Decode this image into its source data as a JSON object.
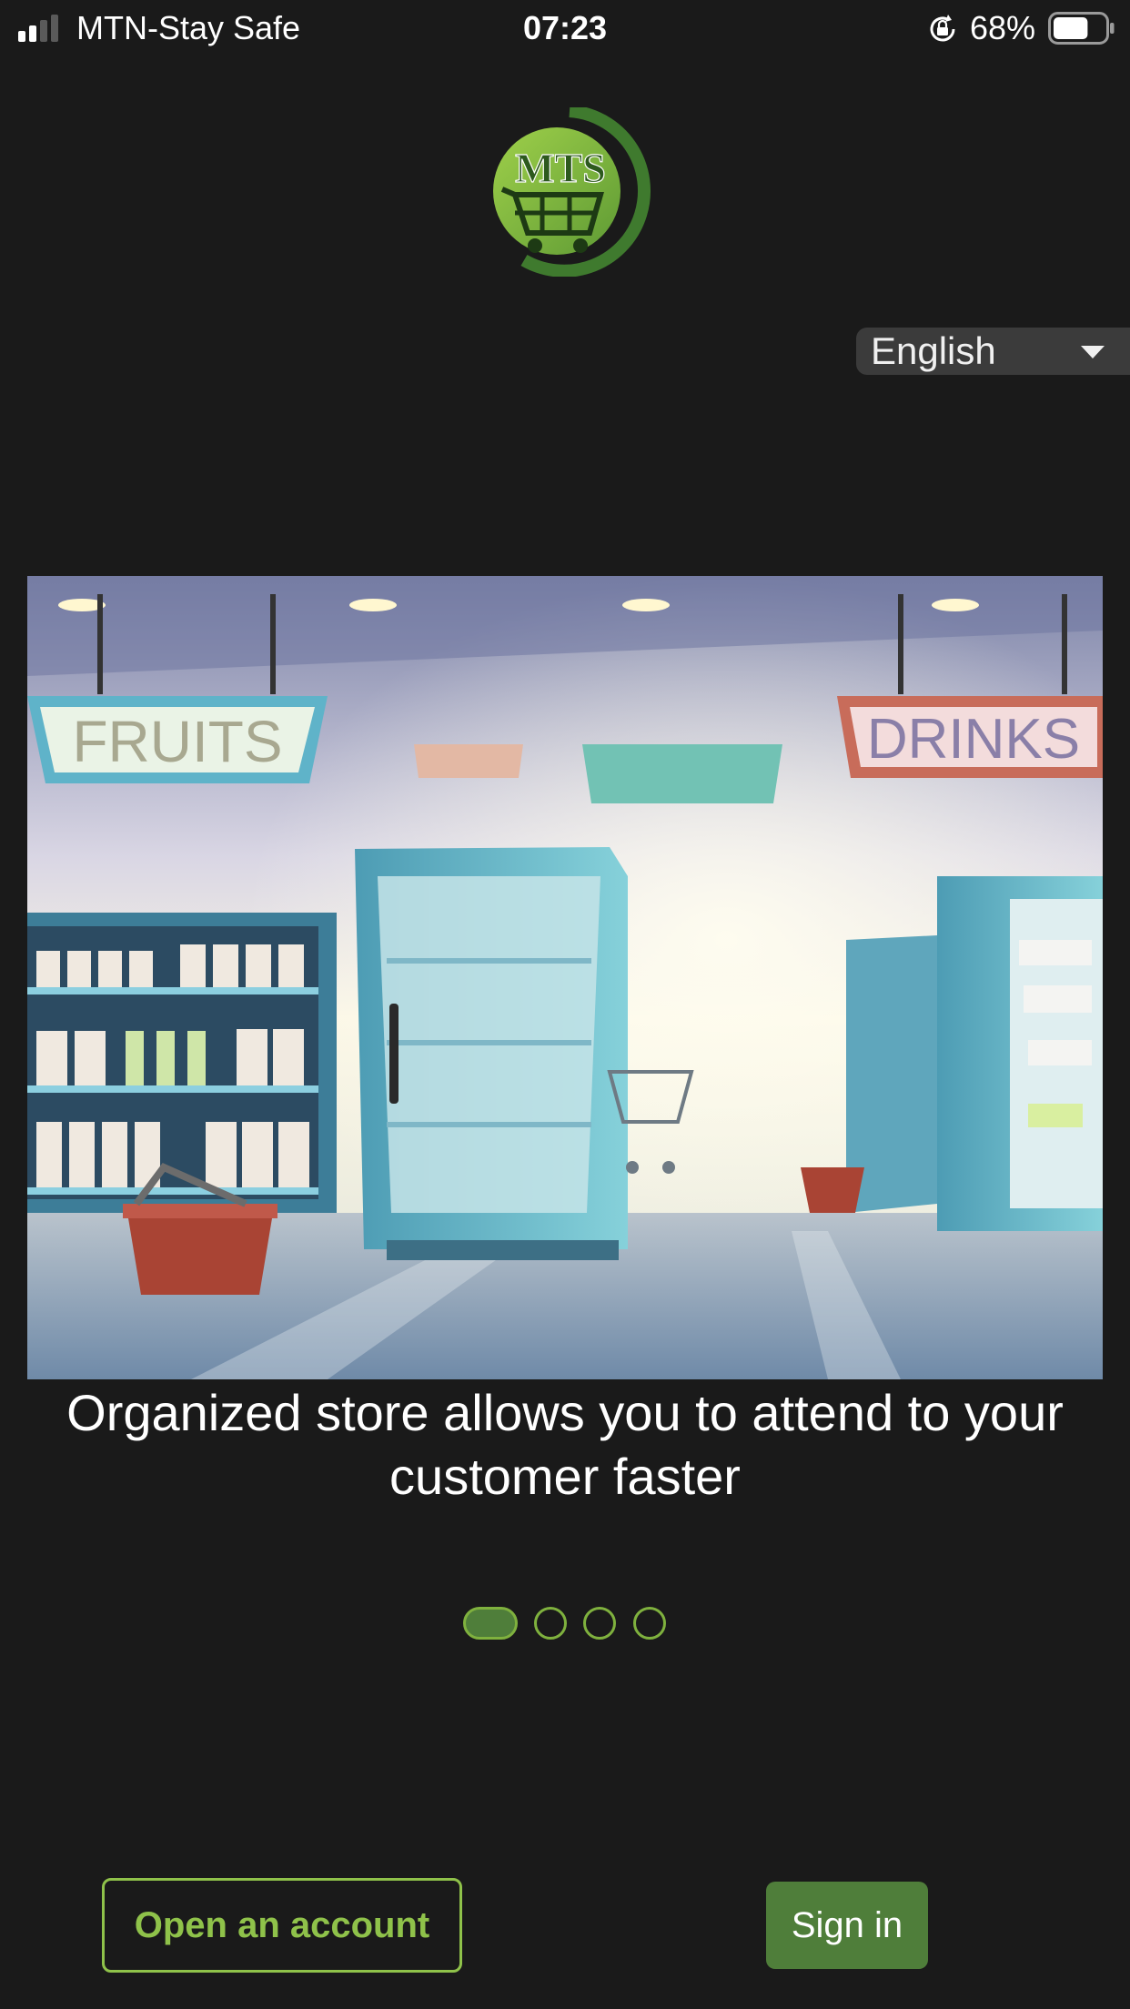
{
  "status_bar": {
    "carrier": "MTN-Stay Safe",
    "time": "07:23",
    "battery_percent": "68%",
    "battery_level": 0.68,
    "signal_bars_filled": 2
  },
  "logo": {
    "text": "MTS",
    "icon": "shopping-cart-globe-icon"
  },
  "language_select": {
    "selected": "English",
    "icon": "caret-down-icon"
  },
  "onboarding": {
    "image": {
      "sign_left": "FRUITS",
      "sign_right": "DRINKS",
      "icon": "supermarket-illustration"
    },
    "caption": "Organized store allows you to attend to your customer faster",
    "page_count": 4,
    "current_page": 1
  },
  "actions": {
    "open_account_label": "Open an account",
    "sign_in_label": "Sign in"
  },
  "colors": {
    "background": "#1a1a1a",
    "accent_green": "#8fc24a",
    "button_green": "#4f7e3a"
  }
}
